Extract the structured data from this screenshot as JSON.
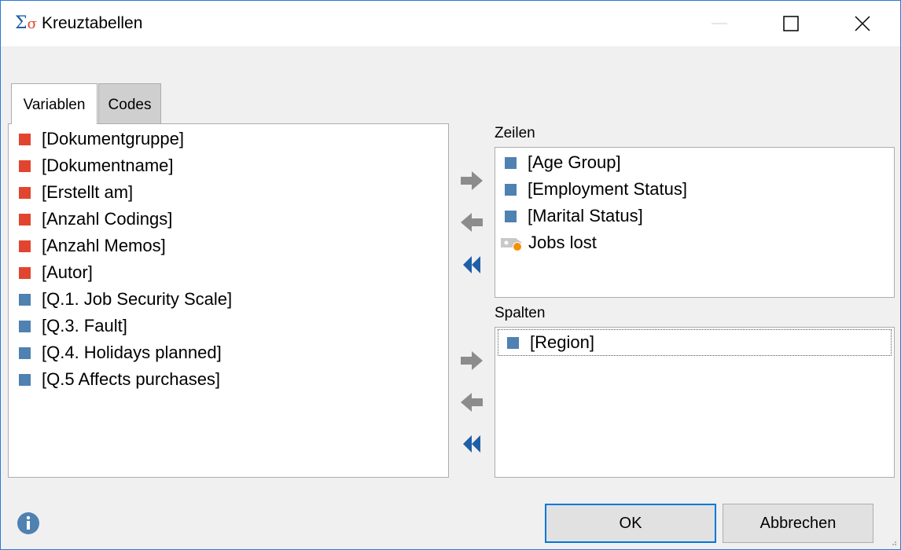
{
  "window": {
    "title": "Kreuztabellen",
    "icon": "sigma-icon",
    "controls": [
      "minimize-icon",
      "maximize-icon",
      "close-icon"
    ]
  },
  "tabs": [
    {
      "label": "Variablen",
      "active": true
    },
    {
      "label": "Codes",
      "active": false
    }
  ],
  "variables": {
    "items": [
      {
        "label": "[Dokumentgruppe]",
        "color": "#e2452f"
      },
      {
        "label": "[Dokumentname]",
        "color": "#e2452f"
      },
      {
        "label": "[Erstellt am]",
        "color": "#e2452f"
      },
      {
        "label": "[Anzahl Codings]",
        "color": "#e2452f"
      },
      {
        "label": "[Anzahl Memos]",
        "color": "#e2452f"
      },
      {
        "label": "[Autor]",
        "color": "#e2452f"
      },
      {
        "label": "[Q.1. Job Security Scale]",
        "color": "#4f81b1"
      },
      {
        "label": "[Q.3. Fault]",
        "color": "#4f81b1"
      },
      {
        "label": "[Q.4. Holidays planned]",
        "color": "#4f81b1"
      },
      {
        "label": "[Q.5 Affects purchases]",
        "color": "#4f81b1"
      }
    ]
  },
  "rows": {
    "label": "Zeilen",
    "items": [
      {
        "label": "[Age Group]",
        "icon": "variable-square-icon"
      },
      {
        "label": "[Employment Status]",
        "icon": "variable-square-icon"
      },
      {
        "label": "[Marital Status]",
        "icon": "variable-square-icon"
      },
      {
        "label": "Jobs lost",
        "icon": "code-tag-icon"
      }
    ]
  },
  "columns": {
    "label": "Spalten",
    "items": [
      {
        "label": "[Region]",
        "icon": "variable-square-icon"
      }
    ]
  },
  "buttons": {
    "ok": "OK",
    "cancel": "Abbrechen"
  },
  "colors": {
    "accent": "#0078d7",
    "system_var": "#e2452f",
    "doc_var": "#4f81b1",
    "arrow_gray": "#8c8c8c",
    "arrow_blue": "#1f5fa8"
  }
}
